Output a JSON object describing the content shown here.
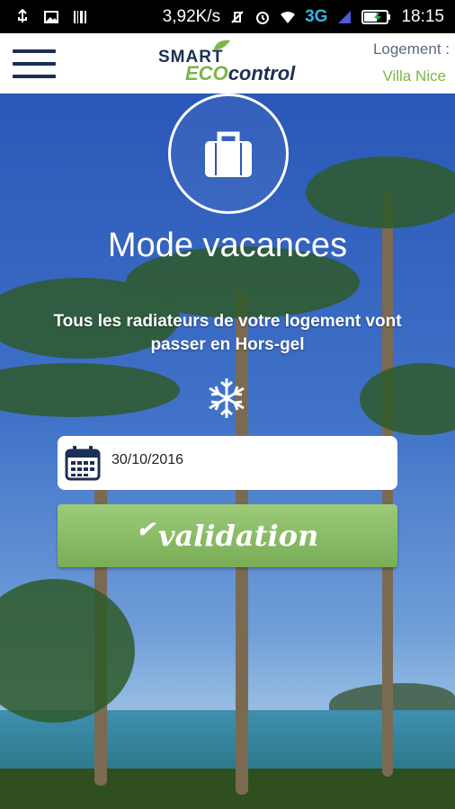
{
  "status_bar": {
    "speed": "3,92K/s",
    "network": "3G",
    "time": "18:15"
  },
  "app_bar": {
    "logo_top": "SMART",
    "logo_eco": "ECO",
    "logo_control": "control",
    "housing_label": "Logement :",
    "housing_value": "Villa Nice"
  },
  "main": {
    "title": "Mode vacances",
    "description": "Tous les radiateurs de votre logement vont passer en Hors-gel",
    "date": "30/10/2016",
    "validate_label": "validation",
    "validate_check": "✔"
  },
  "icons": {
    "menu": "hamburger-menu-icon",
    "suitcase": "suitcase-icon",
    "snowflake": "snowflake-icon",
    "calendar": "calendar-icon"
  },
  "colors": {
    "brand_navy": "#1c2f54",
    "brand_green": "#7ab648",
    "button_green": "#79ad55"
  }
}
